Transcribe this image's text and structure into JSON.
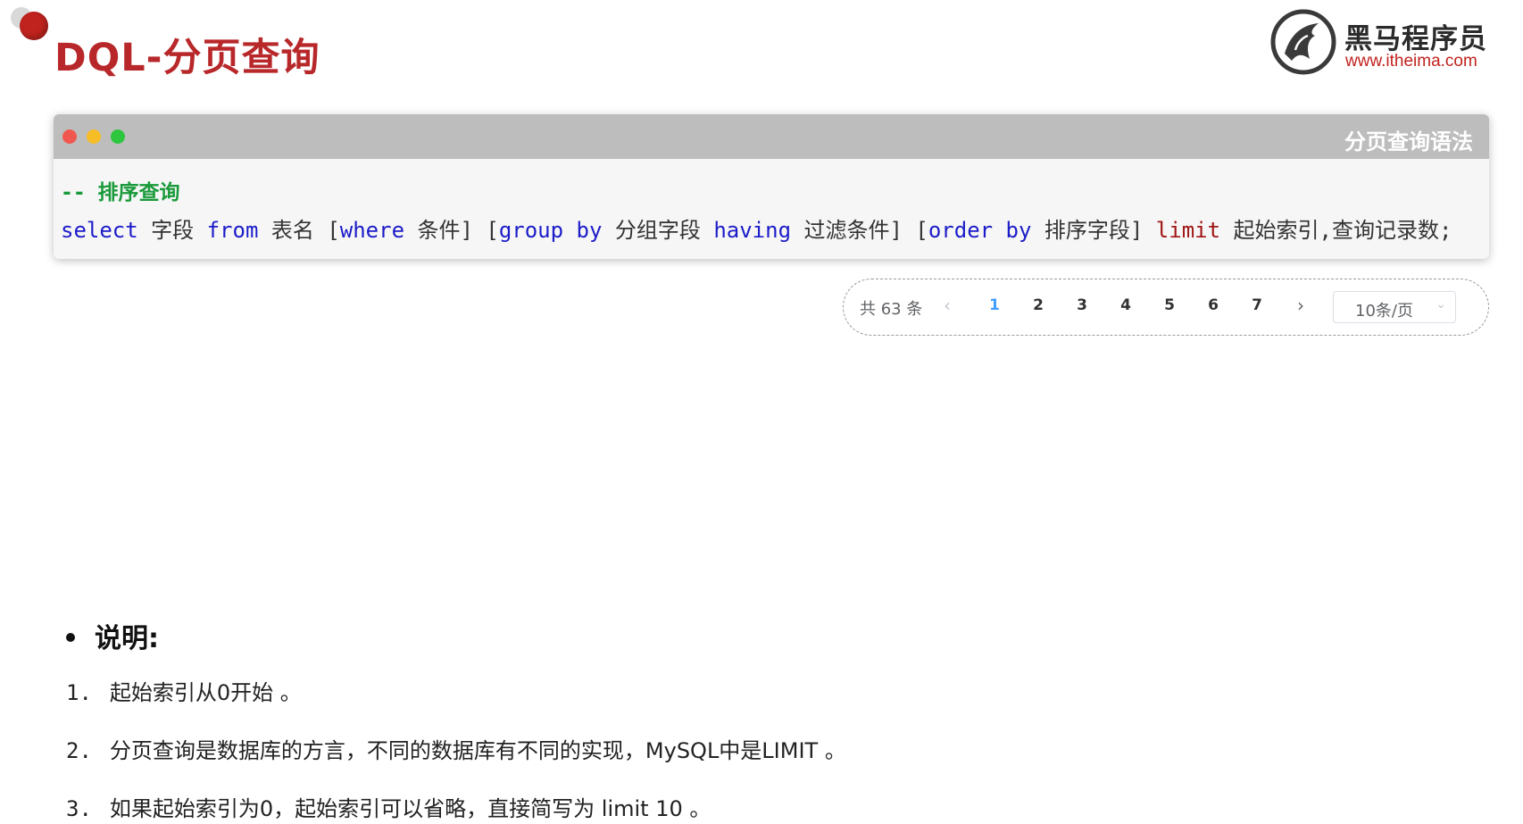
{
  "header": {
    "title": "DQL-分页查询",
    "logo_name": "黑马程序员",
    "logo_url": "www.itheima.com"
  },
  "code_window": {
    "title": "分页查询语法",
    "comment": "-- 排序查询",
    "tokens": {
      "select": "select",
      "field": "字段",
      "from": "from",
      "table": "表名",
      "where_open": "[",
      "where": "where",
      "condition": "条件]",
      "group_open": "[",
      "group_by": "group by",
      "group_field": "分组字段",
      "having": "having",
      "filter": "过滤条件]",
      "order_open": "[",
      "order_by": "order by",
      "sort_field": "排序字段]",
      "limit": "limit",
      "limit_args": "起始索引,查询记录数;"
    },
    "colors": {
      "keyword": "#1c1cc9",
      "limit": "#a01616",
      "comment": "#1a9a3a"
    }
  },
  "pagination": {
    "total": "共 63 条",
    "prev_icon": "chevron-left-icon",
    "next_icon": "chevron-right-icon",
    "pages": [
      "1",
      "2",
      "3",
      "4",
      "5",
      "6",
      "7"
    ],
    "active_page": "1",
    "page_size": "10条/页",
    "active_color": "#409eff"
  },
  "notes": {
    "heading": "说明:",
    "items": [
      {
        "num": "1.",
        "text": "起始索引从0开始 。"
      },
      {
        "num": "2.",
        "text": "分页查询是数据库的方言，不同的数据库有不同的实现，MySQL中是LIMIT 。"
      },
      {
        "num": "3.",
        "text": "如果起始索引为0，起始索引可以省略，直接简写为 limit 10 。"
      }
    ]
  },
  "colors": {
    "title_red": "#b8282a",
    "brand_red": "#c0231e"
  }
}
